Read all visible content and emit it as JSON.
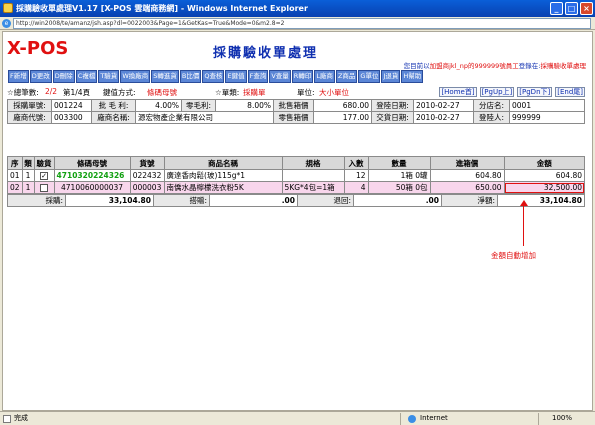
{
  "window": {
    "title": "採購驗收單處理V1.17 [X-POS 雲端商務網] - Windows Internet Explorer",
    "url": "http://win2008/te/amanz/jsh.asp?dl=0022003&Page=1&GetKas=True&Mode=0&m2.8=2",
    "minimize": "_",
    "maximize": "□",
    "close": "×"
  },
  "header": {
    "logo": "X-POS",
    "page_title": "採購驗收單處理",
    "status_prefix": "您目前以",
    "status_user": "加盟商jkl_np的999999號員工",
    "status_mid": "登錄在:",
    "status_module": "採購驗收單處理"
  },
  "toolbar": {
    "buttons": [
      "F新增",
      "D更改",
      "D刪除",
      "C複檔",
      "T驗貨",
      "W換廠商",
      "S轉進貨",
      "B比價",
      "Q查核",
      "E鍵值",
      "F查詢",
      "V查量",
      "R轉印",
      "L廠商",
      "Z商品",
      "G單位",
      "J退貨",
      "H幫助"
    ]
  },
  "info": {
    "total_label": "☆總筆數:",
    "total_value": "2/2",
    "page_label": "第1/4頁",
    "key_mode_label": "鍵值方式:",
    "key_mode_value": "條碼母號",
    "unit_prefix": "☆單類:",
    "unit_value": "採購單",
    "unit_label2": "單位:",
    "unit_value2": "大小單位",
    "nav": [
      "[Home首]",
      "[PgUp上]",
      "[PgDn下]",
      "[End尾]"
    ]
  },
  "form": {
    "row1": {
      "order_no_label": "採購單號:",
      "order_no": "001224",
      "margin_label": "批 毛 利:",
      "margin_value": "4.00%",
      "retail_margin_label": "零毛利:",
      "retail_margin_value": "8.00%",
      "box_price_label": "批售箱價",
      "box_price_value": "680.00",
      "login_date_label": "登陸日期:",
      "login_date": "2010-02-27",
      "branch_label": "分店名:",
      "branch_value": "0001"
    },
    "row2": {
      "vendor_code_label": "廠商代號:",
      "vendor_code": "003300",
      "vendor_name_label": "廠商名稱:",
      "vendor_name": "源宏物產企業有限公司",
      "retail_box_label": "零售箱價",
      "retail_box_value": "177.00",
      "trade_date_label": "交貨日期:",
      "trade_date": "2010-02-27",
      "operator_label": "登陸人:",
      "operator_value": "999999"
    }
  },
  "grid": {
    "columns": [
      "序",
      "類",
      "驗貨",
      "條碼母號",
      "貨號",
      "商品名稱",
      "規格",
      "入數",
      "數量",
      "進箱價",
      "金額"
    ],
    "rows": [
      {
        "seq": "01",
        "type": "1",
        "checked": "✓",
        "barcode": "4710320224326",
        "item_no": "022432",
        "name": "廣達香肉鬆(玻)115g*1",
        "spec": "",
        "pack": "12",
        "qty": "1箱 0罐",
        "price": "604.80",
        "amount": "604.80"
      },
      {
        "seq": "02",
        "type": "1",
        "checked": "",
        "barcode": "4710060000037",
        "item_no": "000003",
        "name": "南僑水晶檸檬洗衣粉5K",
        "spec": "5KG*4包=1箱",
        "pack": "4",
        "qty": "50箱 0包",
        "price": "650.00",
        "amount": "32,500.00"
      }
    ]
  },
  "totals": {
    "purchase_label": "採購:",
    "purchase_value": "33,104.80",
    "gift_label": "搭贈:",
    "gift_value": ".00",
    "return_label": "退回:",
    "return_value": ".00",
    "net_label": "淨額:",
    "net_value": "33,104.80"
  },
  "annotation": "金額自動增加",
  "statusbar": {
    "done": "完成",
    "zone": "Internet",
    "zoom": "100%"
  },
  "colors": {
    "accent_red": "#e01010",
    "title_blue": "#1030b0",
    "toolbar_blue": "#5b86d6",
    "row_highlight_pink": "#f8d6ec",
    "barcode_green": "#10a010"
  }
}
